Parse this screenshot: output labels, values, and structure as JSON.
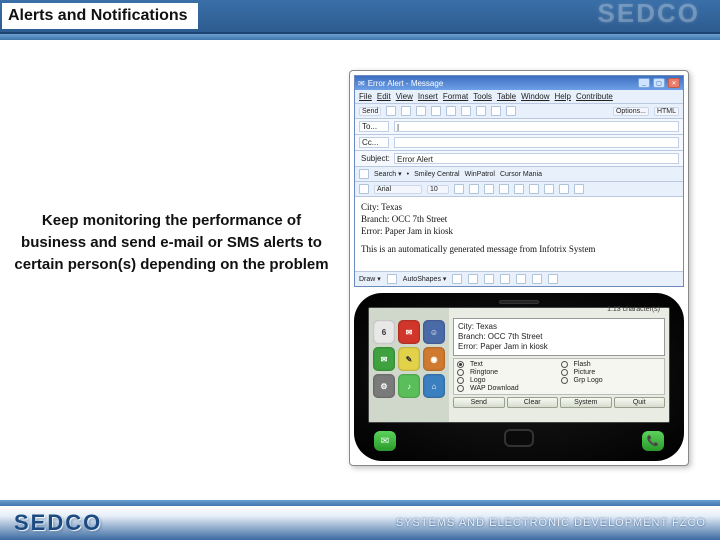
{
  "slide": {
    "title": "Alerts and Notifications",
    "tagline": "Keep monitoring the performance of business and send e-mail or SMS alerts to certain person(s) depending on the problem",
    "header_logo_ghost": "SEDCO"
  },
  "email": {
    "window_title": "Error Alert - Message",
    "menu": [
      "File",
      "Edit",
      "View",
      "Insert",
      "Format",
      "Tools",
      "Table",
      "Window",
      "Help",
      "Contribute"
    ],
    "send_label": "Send",
    "options_label": "Options...",
    "format_sel": "HTML",
    "to_label": "To...",
    "to_value": "|",
    "cc_label": "Cc...",
    "cc_value": "",
    "subject_label": "Subject:",
    "subject_value": "Error Alert",
    "quickbar": [
      "Search ▾",
      "Smiley Central",
      "WinPatrol",
      "Cursor Mania"
    ],
    "font_name": "Arial",
    "font_size": "10",
    "body_lines": [
      "City: Texas",
      "Branch: OCC 7th Street",
      "Error: Paper Jam in kiosk"
    ],
    "body_note": "This is an automatically generated message from Infotrix System",
    "draw_label": "Draw ▾",
    "autoshapes_label": "AutoShapes ▾"
  },
  "phone": {
    "status": "1:13 character(s)",
    "sms_lines": [
      "City: Texas",
      "Branch: OCC 7th Street",
      "Error: Paper Jam in kiosk"
    ],
    "options": [
      {
        "label": "Text",
        "selected": true
      },
      {
        "label": "Flash",
        "selected": false
      },
      {
        "label": "Ringtone",
        "selected": false
      },
      {
        "label": "Picture",
        "selected": false
      },
      {
        "label": "Logo",
        "selected": false
      },
      {
        "label": "Grp Logo",
        "selected": false
      },
      {
        "label": "WAP Download",
        "selected": false
      }
    ],
    "softkeys": [
      "Send",
      "Clear",
      "System",
      "Quit"
    ]
  },
  "footer": {
    "logo": "SEDCO",
    "tagline": "SYSTEMS AND ELECTRONIC DEVELOPMENT FZCO"
  }
}
